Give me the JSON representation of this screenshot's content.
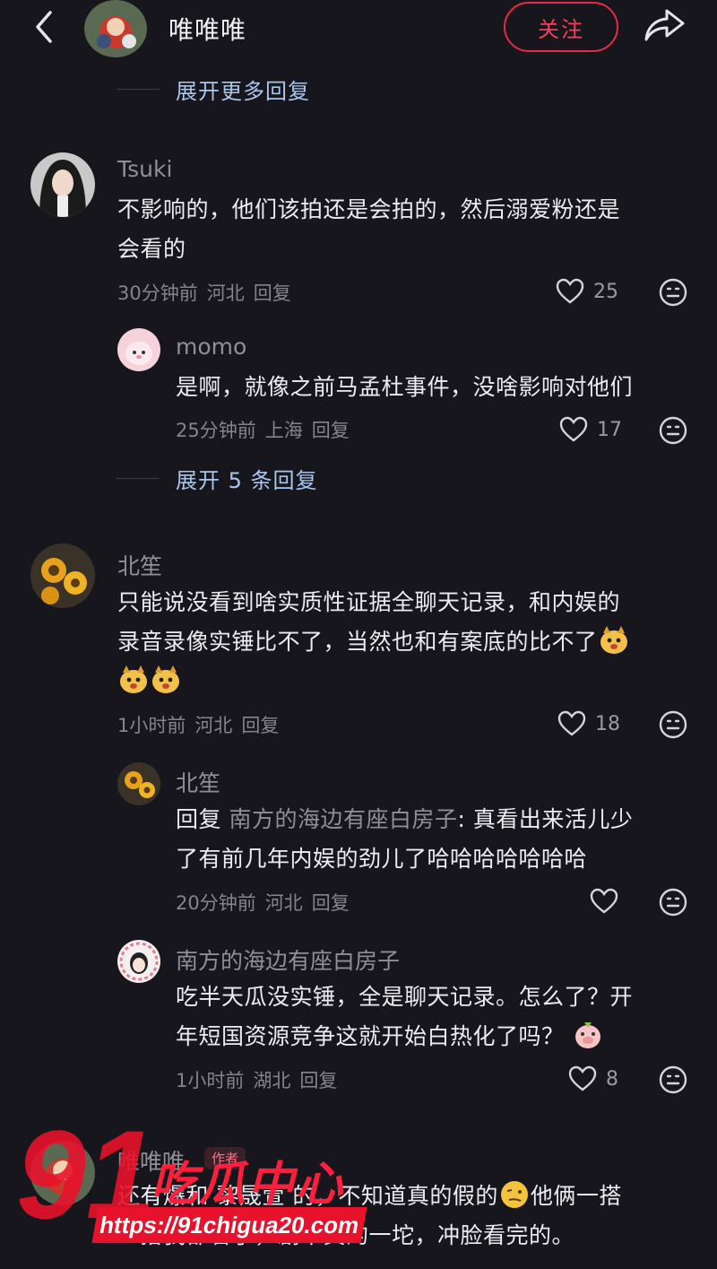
{
  "header": {
    "name": "唯唯唯",
    "follow_label": "关注"
  },
  "top_expand": "展开更多回复",
  "comments": [
    {
      "username": "Tsuki",
      "text": [
        "不影响的，他们该拍还是会拍的，然后溺爱粉还是",
        "会看的"
      ],
      "time": "30分钟前",
      "location": "河北",
      "reply_label": "回复",
      "likes": "25"
    },
    {
      "username": "momo",
      "text": [
        "是啊，就像之前马孟杜事件，没啥影响对他们"
      ],
      "time": "25分钟前",
      "location": "上海",
      "reply_label": "回复",
      "likes": "17"
    },
    {
      "expand": "展开 5 条回复"
    },
    {
      "username": "北笙",
      "text": [
        "只能说没看到啥实质性证据全聊天记录，和内娱的",
        "录音录像实锤比不了，当然也和有案底的比不了"
      ],
      "time": "1小时前",
      "location": "河北",
      "reply_label": "回复",
      "likes": "18"
    },
    {
      "username": "北笙",
      "reply_prefix": "回复",
      "reply_to": "南方的海边有座白房子",
      "text": [
        ": 真看出来活儿少",
        "了有前几年内娱的劲儿了哈哈哈哈哈哈哈"
      ],
      "time": "20分钟前",
      "location": "河北",
      "reply_label": "回复",
      "likes": ""
    },
    {
      "username": "南方的海边有座白房子",
      "text": [
        "吃半天瓜没实锤，全是聊天记录。怎么了？开",
        "年短国资源竞争这就开始白热化了吗？"
      ],
      "time": "1小时前",
      "location": "湖北",
      "reply_label": "回复",
      "likes": "8"
    },
    {
      "username": "唯唯唯",
      "badge": "作者",
      "text": [
        "还有爆和 黎晟萱 的，不知道真的假的",
        "一搭我都看了，剧本真的一坨，冲脸看完的。"
      ]
    }
  ],
  "watermark": {
    "title": "吃瓜中心",
    "number": "91",
    "url": "https://91chigua20.com"
  },
  "colors": {
    "background": "#16161c",
    "accent": "#e8294a",
    "link": "#a9c6ec"
  }
}
